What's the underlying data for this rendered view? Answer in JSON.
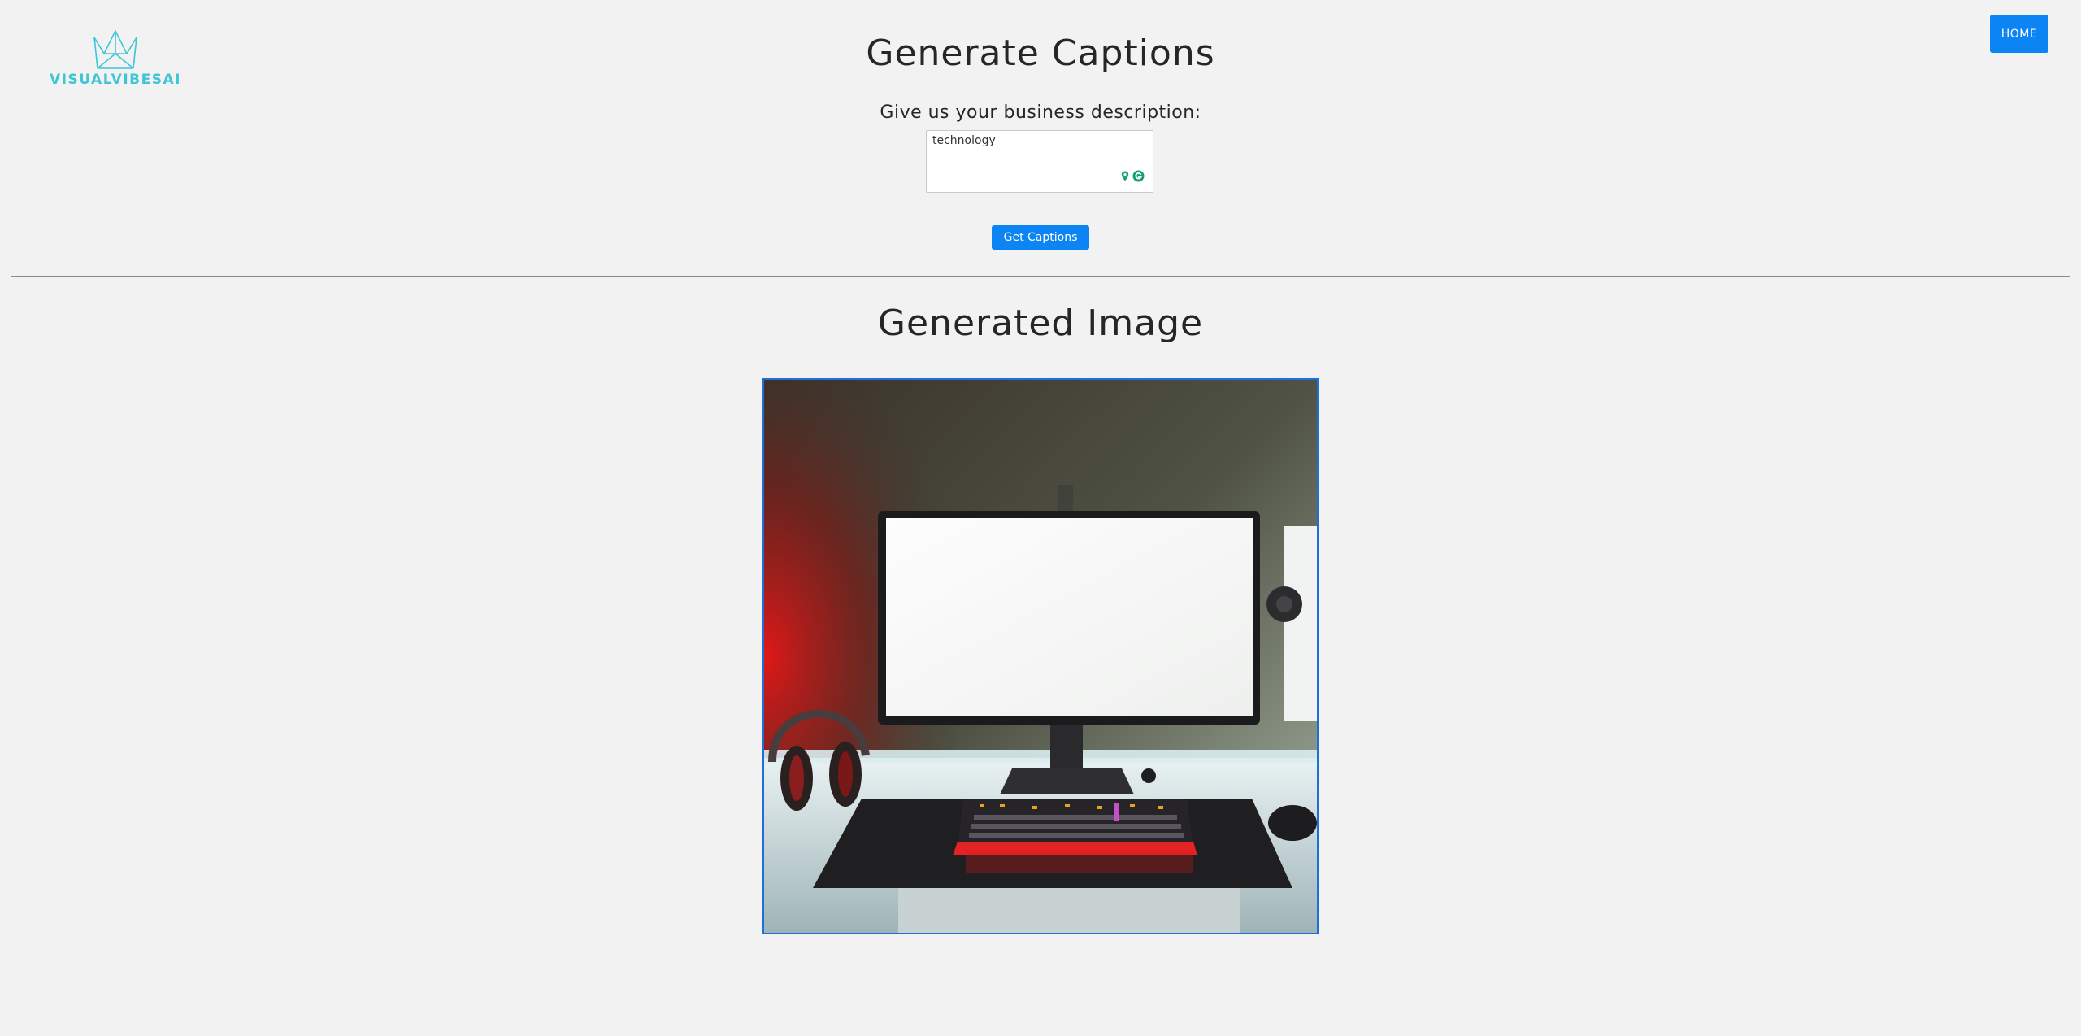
{
  "logo": {
    "text": "VISUALVIBESAI",
    "icon": "crown-icon",
    "color": "#3ec5d6"
  },
  "nav": {
    "home_label": "HOME"
  },
  "captions_section": {
    "title": "Generate Captions",
    "prompt_label": "Give us your business description:",
    "description_value": "technology",
    "submit_label": "Get Captions"
  },
  "image_section": {
    "title": "Generated Image",
    "image_subject": "gaming desk setup with monitor, keyboard, headphones"
  },
  "colors": {
    "accent": "#0d84f3",
    "background": "#f2f2f2",
    "image_border": "#1e6fd9"
  }
}
